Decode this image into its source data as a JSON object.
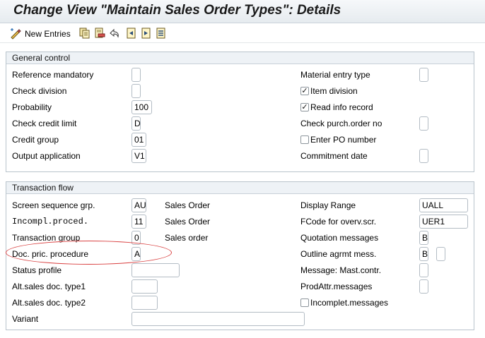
{
  "title": "Change View \"Maintain Sales Order Types\": Details",
  "toolbar": {
    "new_entries": "New Entries",
    "icons": [
      "new-entries-icon",
      "copy-icon",
      "delete-icon",
      "undo-icon",
      "previous-entry-icon",
      "next-entry-icon",
      "select-all-icon"
    ]
  },
  "general": {
    "header": "General control",
    "reference_mandatory": "Reference mandatory",
    "reference_mandatory_value": "",
    "check_division": "Check division",
    "check_division_value": "",
    "probability": "Probability",
    "probability_value": "100",
    "check_credit_limit": "Check credit limit",
    "check_credit_limit_value": "D",
    "credit_group": "Credit group",
    "credit_group_value": "01",
    "output_application": "Output application",
    "output_application_value": "V1",
    "material_entry_type": "Material entry type",
    "material_entry_type_value": "",
    "item_division": "Item division",
    "item_division_checked": true,
    "read_info_record": "Read info record",
    "read_info_record_checked": true,
    "check_purch_order_no": "Check purch.order no",
    "check_purch_order_no_value": "",
    "enter_po_number": "Enter PO number",
    "enter_po_number_checked": false,
    "commitment_date": "Commitment  date",
    "commitment_date_value": ""
  },
  "transaction": {
    "header": "Transaction flow",
    "screen_seq_grp": "Screen sequence grp.",
    "screen_seq_grp_value": "AU",
    "screen_seq_grp_text": "Sales Order",
    "incompl_proced": "Incompl.proced.",
    "incompl_proced_value": "11",
    "incompl_proced_text": "Sales Order",
    "transaction_group": "Transaction group",
    "transaction_group_value": "0",
    "transaction_group_text": "Sales order",
    "doc_pric_procedure": "Doc. pric. procedure",
    "doc_pric_procedure_value": "A",
    "status_profile": "Status profile",
    "status_profile_value": "",
    "alt_sales_doc_type1": "Alt.sales doc. type1",
    "alt_sales_doc_type1_value": "",
    "alt_sales_doc_type2": "Alt.sales doc. type2",
    "alt_sales_doc_type2_value": "",
    "variant": "Variant",
    "variant_value": "",
    "display_range": "Display Range",
    "display_range_value": "UALL",
    "fcode_overv": "FCode for overv.scr.",
    "fcode_overv_value": "UER1",
    "quotation_messages": "Quotation messages",
    "quotation_messages_value": "B",
    "outline_agrmt_mess": "Outline agrmt mess.",
    "outline_agrmt_mess_value": "B",
    "outline_agrmt_mess_extra": "",
    "message_mast_contr": "Message: Mast.contr.",
    "message_mast_contr_value": "",
    "prodattr_messages": "ProdAttr.messages",
    "prodattr_messages_value": "",
    "incomplet_messages": "Incomplet.messages",
    "incomplet_messages_checked": false
  },
  "colors": {
    "annotation_ellipse": "#d94040",
    "group_header_bg": "#eef2f6",
    "field_border": "#b3bcc4"
  }
}
